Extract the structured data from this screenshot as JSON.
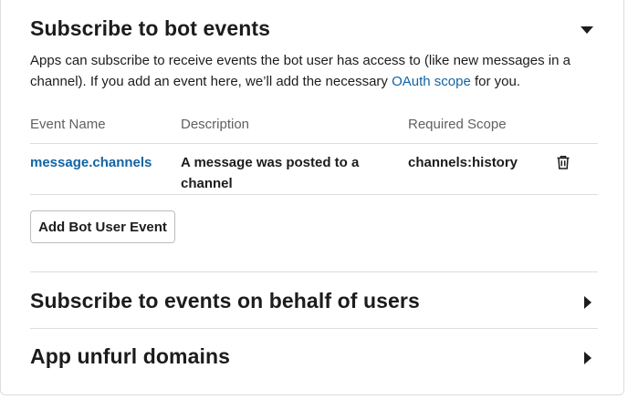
{
  "bot_events": {
    "title": "Subscribe to bot events",
    "description_before_link": "Apps can subscribe to receive events the bot user has access to (like new messages in a channel). If you add an event here, we’ll add the necessary ",
    "description_link": "OAuth scope",
    "description_after_link": " for you.",
    "columns": [
      "Event Name",
      "Description",
      "Required Scope"
    ],
    "rows": [
      {
        "event_name": "message.channels",
        "description": "A message was posted to a channel",
        "scope": "channels:history",
        "action_icon": "trash-icon"
      }
    ],
    "add_button_label": "Add Bot User Event",
    "toggle_icon": "caret-down-icon"
  },
  "user_events": {
    "title": "Subscribe to events on behalf of users",
    "toggle_icon": "caret-right-icon"
  },
  "unfurl_domains": {
    "title": "App unfurl domains",
    "toggle_icon": "caret-right-icon"
  },
  "colors": {
    "link": "#1264a3",
    "text": "#1d1c1d",
    "muted": "#616061",
    "divider": "#dddddd"
  }
}
